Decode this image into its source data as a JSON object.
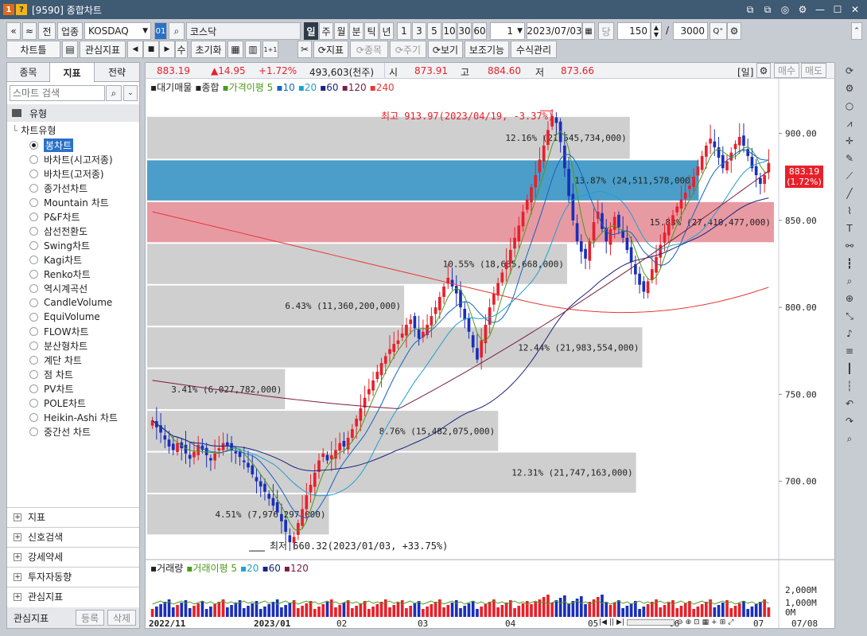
{
  "window": {
    "title": "[9590] 종합차트",
    "logo1": "1",
    "logo2": "?",
    "btns": [
      "⧉",
      "⧉",
      "◎",
      "⚙",
      "—",
      "☐",
      "✕"
    ]
  },
  "toolbar1": {
    "back": "«",
    "up": "≈",
    "prev": "전",
    "sector": "업종",
    "market": "KOSDAQ",
    "market_code": "01",
    "search": "⌕",
    "name": "코스닥",
    "periods": [
      "일",
      "주",
      "월",
      "분",
      "틱",
      "년"
    ],
    "nums": [
      "1",
      "3",
      "5",
      "10",
      "30",
      "60"
    ],
    "count": "1",
    "date": "2023/07/03",
    "dang": "당",
    "bars": "150",
    "slash": "/",
    "max": "3000",
    "zoom": "Q⁺",
    "gear": "⚙"
  },
  "toolbar2": {
    "chartset": "차트틀",
    "save": "▤",
    "fav": "관심지표",
    "play": [
      "◀",
      "■",
      "▶"
    ],
    "su": "수",
    "reset": "초기화",
    "grid1": "▦",
    "grid2": "▥",
    "one": "1+1",
    "cut": "✂",
    "indicator": "⟳지표",
    "stock": "⟳종목",
    "period": "⟳주기",
    "view": "⟳보기",
    "aux": "보조기능",
    "formula": "수식관리"
  },
  "lefttabs": [
    "종목",
    "지표",
    "전략"
  ],
  "search_placeholder": "스마트 검색",
  "tree": {
    "group": "유형",
    "sub": "차트유형",
    "items": [
      "봉차트",
      "바차트(시고저종)",
      "바차트(고저종)",
      "종가선차트",
      "Mountain 차트",
      "P&F차트",
      "삼선전환도",
      "Swing차트",
      "Kagi차트",
      "Renko차트",
      "역시계곡선",
      "CandleVolume",
      "EquiVolume",
      "FLOW차트",
      "분산형차트",
      "계단 차트",
      "점 차트",
      "PV차트",
      "POLE차트",
      "Heikin-Ashi 차트",
      "중간선 차트"
    ],
    "selected": 0
  },
  "bottomgroups": [
    "지표",
    "신호검색",
    "강세약세",
    "투자자동향",
    "관심지표"
  ],
  "footer": {
    "label": "관심지표",
    "reg": "등록",
    "del": "삭제"
  },
  "price": {
    "last": "883.19",
    "change": "▲14.95",
    "pct": "+1.72%",
    "volume": "493,603(천주)",
    "open_l": "시",
    "open": "873.91",
    "high_l": "고",
    "high": "884.60",
    "low_l": "저",
    "low": "873.66",
    "period": "[일]",
    "buy": "매수",
    "sell": "매도"
  },
  "legend": {
    "a": "대기매물",
    "b": "종합",
    "c": "가격이평 5",
    "d": "10",
    "e": "20",
    "f": "60",
    "g": "120",
    "h": "240"
  },
  "vol_legend": {
    "a": "거래량",
    "b": "거래이평 5",
    "c": "20",
    "d": "60",
    "e": "120"
  },
  "annot": {
    "high": "최고 913.97(2023/04/19, -3.37%)",
    "low": "최저 660.32(2023/01/03, +33.75%)",
    "price_tag": "883.19",
    "price_tag_pct": "(1.72%)"
  },
  "chart_data": {
    "type": "candlestick",
    "x_labels": [
      "2022/11",
      "2023/01",
      "02",
      "03",
      "04",
      "05",
      "06",
      "07",
      "07/08"
    ],
    "y_ticks": [
      700,
      750,
      800,
      850,
      900
    ],
    "y_labels": [
      "700.00",
      "750.00",
      "800.00",
      "850.00",
      "900.00"
    ],
    "ylim": [
      655,
      925
    ],
    "vol_labels": [
      "2,000M",
      "1,000M",
      "0M"
    ],
    "supply_bands": [
      {
        "lo": 885,
        "hi": 910,
        "pct": "12.16%",
        "vol": "(21,545,734,000)",
        "len": 0.77
      },
      {
        "lo": 861,
        "hi": 885,
        "pct": "13.87%",
        "vol": "(24,511,578,000)",
        "len": 0.88
      },
      {
        "lo": 837,
        "hi": 861,
        "pct": "15.83%",
        "vol": "(27,410,477,000)",
        "len": 1.0
      },
      {
        "lo": 813,
        "hi": 837,
        "pct": "10.55%",
        "vol": "(18,635,668,000)",
        "len": 0.67
      },
      {
        "lo": 789,
        "hi": 813,
        "pct": "6.43%",
        "vol": "(11,360,200,000)",
        "len": 0.41
      },
      {
        "lo": 765,
        "hi": 789,
        "pct": "12.44%",
        "vol": "(21,983,554,000)",
        "len": 0.79
      },
      {
        "lo": 741,
        "hi": 765,
        "pct": "3.41%",
        "vol": "(6,027,782,000)",
        "len": 0.22
      },
      {
        "lo": 717,
        "hi": 741,
        "pct": "8.76%",
        "vol": "(15,482,075,000)",
        "len": 0.56
      },
      {
        "lo": 693,
        "hi": 717,
        "pct": "12.31%",
        "vol": "(21,747,163,000)",
        "len": 0.78
      },
      {
        "lo": 669,
        "hi": 693,
        "pct": "4.51%",
        "vol": "(7,976,297,000)",
        "len": 0.29
      }
    ],
    "closes": [
      735,
      731,
      728,
      724,
      720,
      718,
      722,
      719,
      716,
      713,
      717,
      721,
      718,
      715,
      712,
      716,
      719,
      722,
      720,
      718,
      716,
      714,
      711,
      708,
      704,
      700,
      697,
      694,
      690,
      686,
      682,
      677,
      671,
      665,
      668,
      676,
      684,
      692,
      698,
      705,
      712,
      716,
      712,
      715,
      718,
      722,
      720,
      725,
      730,
      736,
      742,
      748,
      753,
      758,
      763,
      768,
      772,
      776,
      779,
      781,
      785,
      790,
      793,
      788,
      782,
      786,
      790,
      795,
      800,
      806,
      812,
      817,
      812,
      808,
      800,
      793,
      786,
      777,
      770,
      781,
      790,
      800,
      808,
      814,
      820,
      826,
      833,
      840,
      847,
      855,
      862,
      869,
      876,
      885,
      893,
      902,
      910,
      906,
      895,
      880,
      864,
      850,
      838,
      832,
      828,
      838,
      849,
      855,
      845,
      838,
      845,
      852,
      846,
      840,
      833,
      826,
      819,
      813,
      809,
      815,
      822,
      829,
      836,
      843,
      848,
      853,
      858,
      862,
      866,
      870,
      875,
      881,
      887,
      893,
      897,
      892,
      886,
      880,
      884,
      889,
      894,
      898,
      893,
      887,
      880,
      876,
      871,
      876,
      883
    ]
  }
}
